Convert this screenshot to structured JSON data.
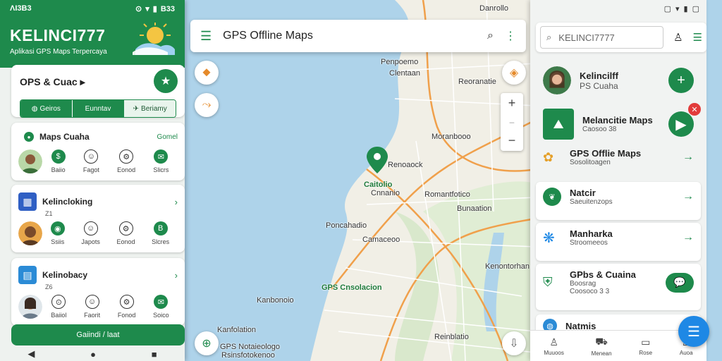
{
  "colors": {
    "primary": "#1e8a4c",
    "water": "#aed3ea",
    "land": "#f1efe6",
    "accent_blue": "#1e88e5",
    "alert": "#e23b3b"
  },
  "left_panel": {
    "status_time": "ΛΙ3Β3",
    "status_right": "Β33",
    "title": "KELINCI777",
    "subtitle": "Aplikasi GPS Maps Terpercaya",
    "search_card": {
      "title": "OPS & Cuac ▸",
      "segments": [
        "Geiros",
        "Eunntav",
        "Beriamy"
      ]
    },
    "cards": [
      {
        "name": "Maps Cuaha",
        "aux": "Gomel",
        "actions": [
          "Baiio",
          "Fagot",
          "Eonod",
          "Slicrs"
        ]
      },
      {
        "name": "Kelincloking",
        "sub": "Z1",
        "actions": [
          "Ssiis",
          "Japots",
          "Eonod",
          "Slcres"
        ]
      },
      {
        "name": "Kelinobacy",
        "sub": "Z6",
        "actions": [
          "Baiiol",
          "Faorit",
          "Fonod",
          "Soico"
        ]
      }
    ],
    "bottom_button": "Gaiindi / laat",
    "nav": [
      "◀",
      "●",
      "■"
    ]
  },
  "topbar": {
    "title": "GPS Offline Maps"
  },
  "map": {
    "labels": [
      "Penpoemo",
      "Clentaan",
      "Danrollo",
      "Reoranatie",
      "Moranbooo",
      "Renoaock",
      "Caitolio",
      "Cnnanio",
      "Romantfotico",
      "Bunaation",
      "Poncahadio",
      "Camaceoo",
      "Kenontorhan",
      "GPS Cnsolacion",
      "Kanbonoio",
      "Kanfolation",
      "Reinblatio",
      "GPS Notaieologo",
      "Rsinsfotokenoo"
    ]
  },
  "right_panel": {
    "status": [
      "▢",
      "▾",
      "▮",
      "▢"
    ],
    "search_placeholder": "KELINCI7777",
    "items": [
      {
        "name": "Kelincilff",
        "sub": "PS Cuaha"
      },
      {
        "name": "Melancitie Maps",
        "sub": "Caosoo 38"
      },
      {
        "name": "GPS Offlie Maps",
        "sub": "Sosolitoagen"
      },
      {
        "name": "Natcir",
        "sub": "Saeuitenzops"
      },
      {
        "name": "Manharka",
        "sub": "Stroomeeos"
      },
      {
        "name": "GPbs & Cuaina",
        "sub": "Boosrag",
        "sub2": "Coosoco 3 3"
      },
      {
        "name": "Natmis"
      }
    ],
    "bottom_nav": [
      "Muuoos",
      "Menean",
      "Rose",
      "Auoa"
    ]
  }
}
